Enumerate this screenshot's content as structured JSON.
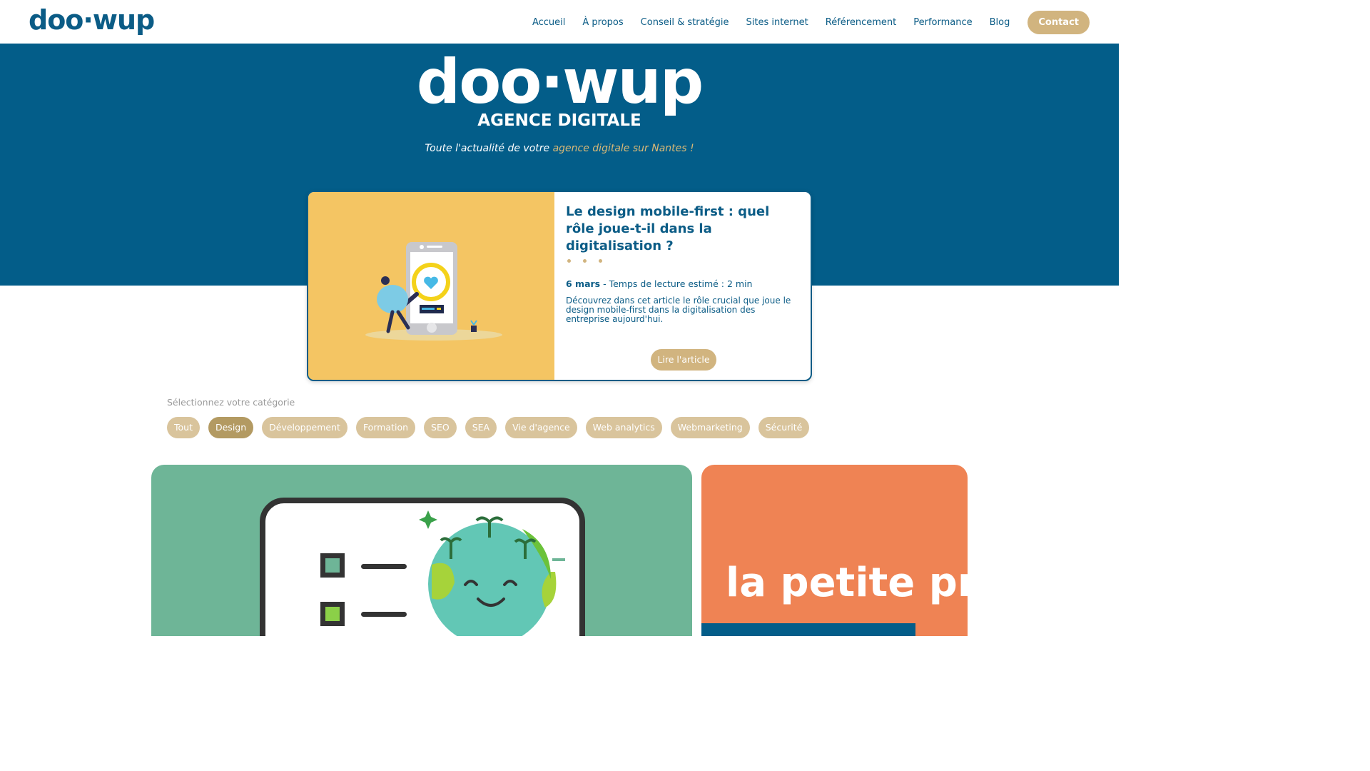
{
  "header": {
    "logo": "doo·wup",
    "nav": [
      "Accueil",
      "À propos",
      "Conseil & stratégie",
      "Sites internet",
      "Référencement",
      "Performance",
      "Blog"
    ],
    "contact": "Contact"
  },
  "hero": {
    "logo": "doo·wup",
    "subtitle": "AGENCE DIGITALE",
    "tagline_prefix": "Toute l'actualité de votre ",
    "tagline_accent": "agence digitale sur Nantes !"
  },
  "featured": {
    "title": "Le design mobile-first : quel rôle joue-t-il dans la digitalisation ?",
    "date": "6 mars",
    "reading_time": " - Temps de lecture estimé : 2 min",
    "excerpt": "Découvrez dans cet article le rôle crucial que joue le design mobile-first dans la digitalisation des entreprise aujourd'hui.",
    "button": "Lire l'article",
    "illustration": "person-magnifier-phone-heart"
  },
  "categories": {
    "label": "Sélectionnez votre catégorie",
    "items": [
      "Tout",
      "Design",
      "Développement",
      "Formation",
      "SEO",
      "SEA",
      "Vie d'agence",
      "Web analytics",
      "Webmarketing",
      "Sécurité"
    ],
    "selected": "Design"
  },
  "cards": {
    "green_illustration": "checklist-happy-earth",
    "orange_text": "la petite production"
  },
  "colors": {
    "brand_blue": "#035d89",
    "gold": "#d1b47f",
    "featured_bg": "#f4c563",
    "green_card": "#6eb597",
    "orange_card": "#ef8354"
  }
}
